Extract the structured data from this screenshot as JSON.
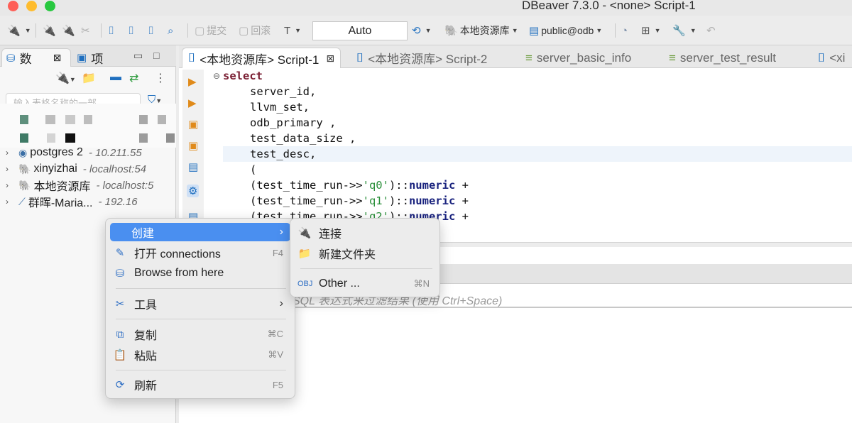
{
  "window": {
    "title": "DBeaver 7.3.0 - <none> Script-1"
  },
  "toolbar": {
    "commit_label": "提交",
    "rollback_label": "回滚",
    "auto_commit_value": "Auto",
    "datasource_label": "本地资源库",
    "schema_label": "public@odb"
  },
  "left_panel": {
    "tab_db": "数",
    "tab_project": "项",
    "filter_placeholder": "输入表格名称的一部",
    "tree": [
      {
        "name": "postgres 2",
        "host": "- 10.211.55"
      },
      {
        "name": "xinyizhai",
        "host": "- localhost:54"
      },
      {
        "name": "本地资源库",
        "host": "- localhost:5"
      },
      {
        "name": "群晖-Maria...",
        "host": "- 192.16"
      }
    ]
  },
  "editor": {
    "tabs": [
      {
        "label": "<本地资源库> Script-1"
      },
      {
        "label": "<本地资源库> Script-2"
      },
      {
        "label": "server_basic_info"
      },
      {
        "label": "server_test_result"
      },
      {
        "label": "<xi"
      }
    ],
    "code": {
      "select": "select",
      "line1": "server_id,",
      "line2": "llvm_set,",
      "line3": "odb_primary ,",
      "line4": "test_data_size ,",
      "line5": "test_desc,",
      "line6": "(",
      "func": "(test_time_run->>",
      "q0": "'q0'",
      "q1": "'q1'",
      "q2": "'q2'",
      "cast": ")::",
      "numeric": "numeric",
      "plus": " +"
    },
    "results_filter_placeholder": "SQL 表达式来过滤结果 (使用 Ctrl+Space)"
  },
  "context_menu": {
    "items": [
      {
        "label": "创建"
      },
      {
        "label": "打开 connections",
        "shortcut": "F4"
      },
      {
        "label": "Browse from here"
      },
      {
        "label": "工具"
      },
      {
        "label": "复制",
        "shortcut": "⌘C"
      },
      {
        "label": "粘贴",
        "shortcut": "⌘V"
      },
      {
        "label": "刷新",
        "shortcut": "F5"
      }
    ]
  },
  "submenu": {
    "items": [
      {
        "label": "连接"
      },
      {
        "label": "新建文件夹"
      },
      {
        "label": "Other ...",
        "shortcut": "⌘N"
      }
    ]
  }
}
